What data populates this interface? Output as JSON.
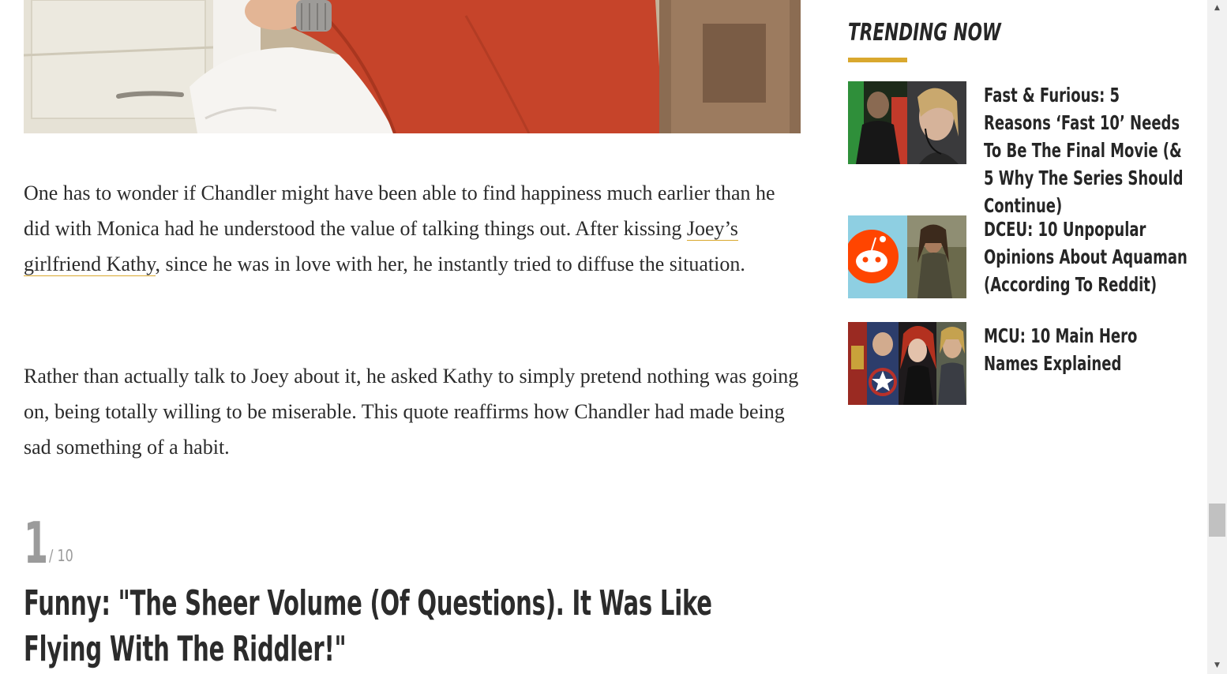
{
  "article": {
    "paragraph_1": {
      "before_link": "One has to wonder if Chandler might have been able to find happiness much earlier than he did with Monica had he understood the value of talking things out. After kissing ",
      "link_text": "Joey’s girlfriend Kathy",
      "after_link": ", since he was in love with her, he instantly tried to diffuse the situation."
    },
    "paragraph_2": "Rather than actually talk to Joey about it, he asked Kathy to simply pretend nothing was going on, being totally willing to be miserable. This quote reaffirms how Chandler had made being sad something of a habit.",
    "rank": {
      "number": "1",
      "total": "/ 10"
    },
    "entry_title": "Funny: \"The Sheer Volume (Of Questions). It Was Like Flying With The Riddler!\""
  },
  "sidebar": {
    "heading": "TRENDING NOW",
    "accent_color": "#d9a82e",
    "items": [
      {
        "title": "Fast & Furious: 5 Reasons ‘Fast 10’ Needs To Be The Final Movie (& 5 Why The Series Should Continue)"
      },
      {
        "title": "DCEU: 10 Unpopular Opinions About Aquaman (According To Reddit)"
      },
      {
        "title": "MCU: 10 Main Hero Names Explained"
      }
    ]
  },
  "scrollbar": {
    "up_arrow": "▲",
    "down_arrow": "▼"
  }
}
